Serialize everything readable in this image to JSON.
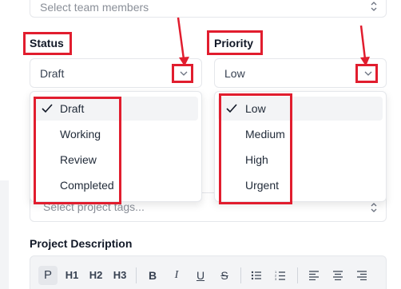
{
  "team_select": {
    "placeholder": "Select team members"
  },
  "status": {
    "label": "Status",
    "value": "Draft",
    "options": [
      "Draft",
      "Working",
      "Review",
      "Completed"
    ],
    "selected": "Draft"
  },
  "priority": {
    "label": "Priority",
    "value": "Low",
    "options": [
      "Low",
      "Medium",
      "High",
      "Urgent"
    ],
    "selected": "Low"
  },
  "tags_select": {
    "placeholder": "Select project tags..."
  },
  "description": {
    "label": "Project Description",
    "toolbar": {
      "paragraph": "P",
      "h1": "H1",
      "h2": "H2",
      "h3": "H3",
      "bold": "B",
      "italic": "I",
      "underline": "U",
      "strike": "S"
    }
  },
  "colors": {
    "annotation_red": "#e11d2e",
    "border": "#e5e7eb",
    "selected_bg": "#f3f4f6"
  },
  "icons": [
    "sort-icon",
    "chevron-down-icon",
    "check-icon",
    "bullet-list-icon",
    "ordered-list-icon",
    "align-left-icon",
    "align-center-icon",
    "align-right-icon"
  ]
}
